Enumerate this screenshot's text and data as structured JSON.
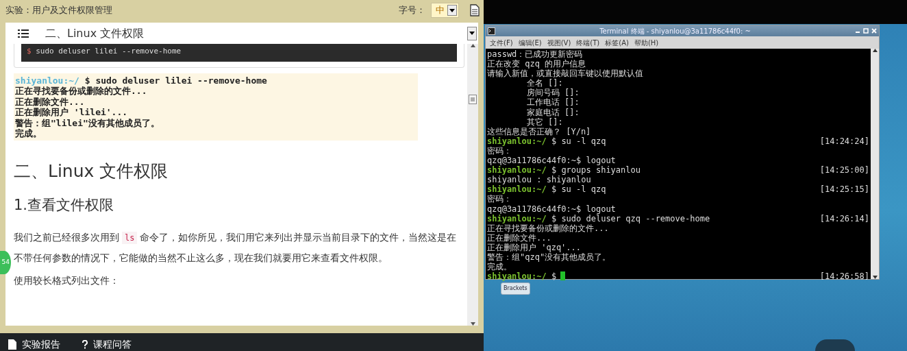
{
  "lesson": {
    "title": "实验：用户及文件权限管理",
    "font_size_label": "字号：",
    "font_size": "中"
  },
  "doc_nav": {
    "current": "二、Linux 文件权限"
  },
  "code_block": {
    "prompt": "$",
    "command": "sudo deluser lilei --remove-home"
  },
  "screenshot": {
    "lines": [
      {
        "kind": "prompt",
        "prompt": "shiyanlou:~/",
        "command": "$ sudo deluser lilei --remove-home"
      },
      {
        "kind": "output",
        "text": "正在寻找要备份或删除的文件..."
      },
      {
        "kind": "output",
        "text": "正在删除文件..."
      },
      {
        "kind": "output",
        "text": "正在删除用户 'lilei'..."
      },
      {
        "kind": "output",
        "text": "警告：组\"lilei\"没有其他成员了。"
      },
      {
        "kind": "output",
        "text": "完成。"
      }
    ]
  },
  "article": [
    {
      "kind": "h2",
      "text": "二、Linux 文件权限"
    },
    {
      "kind": "h3",
      "text": "1.查看文件权限"
    },
    {
      "kind": "p",
      "before": "我们之前已经很多次用到",
      "code": "ls",
      "after": "命令了，如你所见，我们用它来列出并显示当前目录下的文件，当然这是在不带任何参数的情况下，它能做的当然不止这么多，现在我们就要用它来查看文件权限。"
    },
    {
      "kind": "p",
      "text": "使用较长格式列出文件："
    }
  ],
  "side_badge": "54",
  "bottom_bar": [
    {
      "kind": "doc",
      "label": "实验报告"
    },
    {
      "kind": "help",
      "label": "课程问答"
    }
  ],
  "terminal": {
    "title": "Terminal 终端 - shiyanlou@3a11786c44f0: ~",
    "menu": [
      "文件(F)",
      "编辑(E)",
      "视图(V)",
      "终端(T)",
      "标签(A)",
      "帮助(H)"
    ],
    "lines": [
      {
        "kind": "output",
        "text": "passwd：已成功更新密码"
      },
      {
        "kind": "output",
        "text": "正在改变 qzq 的用户信息"
      },
      {
        "kind": "output",
        "text": "请输入新值，或直接敲回车键以使用默认值"
      },
      {
        "kind": "output",
        "text": "        全名 []:"
      },
      {
        "kind": "output",
        "text": "        房间号码 []:"
      },
      {
        "kind": "output",
        "text": "        工作电话 []:"
      },
      {
        "kind": "output",
        "text": "        家庭电话 []:"
      },
      {
        "kind": "output",
        "text": "        其它 []:"
      },
      {
        "kind": "output",
        "text": "这些信息是否正确？ [Y/n]"
      },
      {
        "kind": "prompt",
        "prompt": "shiyanlou:~/",
        "command": "$ su -l qzq",
        "time": "[14:24:24]",
        "cursor": false
      },
      {
        "kind": "output",
        "text": "密码："
      },
      {
        "kind": "output",
        "text": "qzq@3a11786c44f0:~$ logout"
      },
      {
        "kind": "prompt",
        "prompt": "shiyanlou:~/",
        "command": "$ groups shiyanlou",
        "time": "[14:25:00]",
        "cursor": false
      },
      {
        "kind": "output",
        "text": "shiyanlou : shiyanlou"
      },
      {
        "kind": "prompt",
        "prompt": "shiyanlou:~/",
        "command": "$ su -l qzq",
        "time": "[14:25:15]",
        "cursor": false
      },
      {
        "kind": "output",
        "text": "密码："
      },
      {
        "kind": "output",
        "text": "qzq@3a11786c44f0:~$ logout"
      },
      {
        "kind": "prompt",
        "prompt": "shiyanlou:~/",
        "command": "$ sudo deluser qzq --remove-home",
        "time": "[14:26:14]",
        "cursor": false
      },
      {
        "kind": "output",
        "text": "正在寻找要备份或删除的文件..."
      },
      {
        "kind": "output",
        "text": "正在删除文件..."
      },
      {
        "kind": "output",
        "text": "正在删除用户 'qzq'..."
      },
      {
        "kind": "output",
        "text": "警告：组\"qzq\"没有其他成员了。"
      },
      {
        "kind": "output",
        "text": "完成。"
      },
      {
        "kind": "prompt",
        "prompt": "shiyanlou:~/",
        "command": "$",
        "time": "[14:26:58]",
        "cursor": true
      }
    ]
  },
  "desktop": {
    "app_label": "Brackets"
  }
}
